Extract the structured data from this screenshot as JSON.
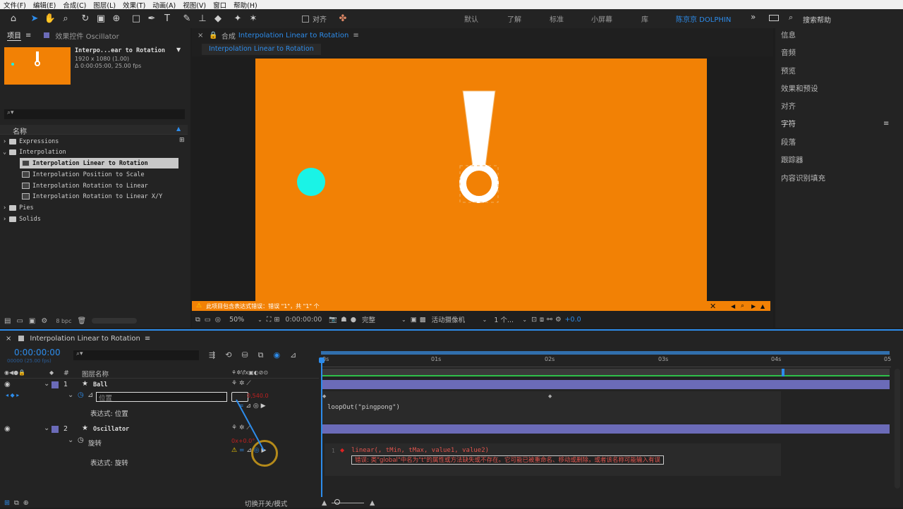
{
  "menu": [
    "文件(F)",
    "编辑(E)",
    "合成(C)",
    "图层(L)",
    "效果(T)",
    "动画(A)",
    "视图(V)",
    "窗口",
    "帮助(H)"
  ],
  "toolbar": {
    "align_label": "对齐",
    "search_placeholder": "搜索帮助"
  },
  "workspaces": [
    "默认",
    "了解",
    "标准",
    "小屏幕",
    "库"
  ],
  "workspace_active": "陈京京 DOLPHIN",
  "project": {
    "tab_project": "项目",
    "tab_effects": "效果控件 Oscillator",
    "preview_name": "Interpo...ear to Rotation",
    "preview_res": "1920 x 1080 (1.00)",
    "preview_dur": "Δ 0:00:05:00, 25.00 fps",
    "col_name": "名称",
    "bpc": "8 bpc",
    "items": [
      {
        "label": "Expressions",
        "type": "folder",
        "level": 0
      },
      {
        "label": "Interpolation",
        "type": "folder",
        "level": 0
      },
      {
        "label": "Interpolation Linear to Rotation",
        "type": "comp",
        "level": 1,
        "selected": true
      },
      {
        "label": "Interpolation Position to Scale",
        "type": "comp",
        "level": 1
      },
      {
        "label": "Interpolation Rotation to Linear",
        "type": "comp",
        "level": 1
      },
      {
        "label": "Interpolation Rotation to Linear X/Y",
        "type": "comp",
        "level": 1
      },
      {
        "label": "Pies",
        "type": "folder",
        "level": 0
      },
      {
        "label": "Solids",
        "type": "folder",
        "level": 0
      }
    ]
  },
  "comp": {
    "tab_prefix": "合成",
    "tab_name": "Interpolation Linear to Rotation",
    "sub_tab": "Interpolation Linear to Rotation",
    "warning": "此项目包含表达式错误：错误 \"1\"，共 \"1\" 个",
    "zoom": "50%",
    "timecode": "0:00:00:00",
    "quality": "完整",
    "camera": "活动摄像机",
    "views": "1 个...",
    "exposure": "+0.0"
  },
  "right_panel": [
    "信息",
    "音频",
    "预览",
    "效果和预设",
    "对齐",
    "字符",
    "段落",
    "跟踪器",
    "内容识别填充"
  ],
  "timeline": {
    "tab": "Interpolation Linear to Rotation",
    "timecode": "0:00:00:00",
    "fps_hint": "00000 (25.00 fps)",
    "col_num": "#",
    "col_layer": "图层名称",
    "ruler": [
      "0s",
      "01s",
      "02s",
      "03s",
      "04s",
      "05"
    ],
    "layers": [
      {
        "num": "1",
        "name": "Ball",
        "prop": "位置",
        "expr_label": "表达式: 位置",
        "value": "0,540.0",
        "expression": "loopOut(\"pingpong\")"
      },
      {
        "num": "2",
        "name": "Oscillator",
        "prop": "旋转",
        "expr_label": "表达式: 旋转",
        "value": "0x+0.0°",
        "expression": "linear(, tMin, tMax, value1, value2)",
        "error": "错误: 类\"global\"中名为\"t\"的属性或方法缺失或不存在。它可能已被重命名、移动或删除，或者该名称可能输入有误"
      }
    ],
    "footer": "切换开关/模式"
  },
  "colors": {
    "orange": "#f28105",
    "ball": "#1af3e6",
    "accent": "#2d8ceb",
    "layer_bar": "#6b6bb8"
  }
}
